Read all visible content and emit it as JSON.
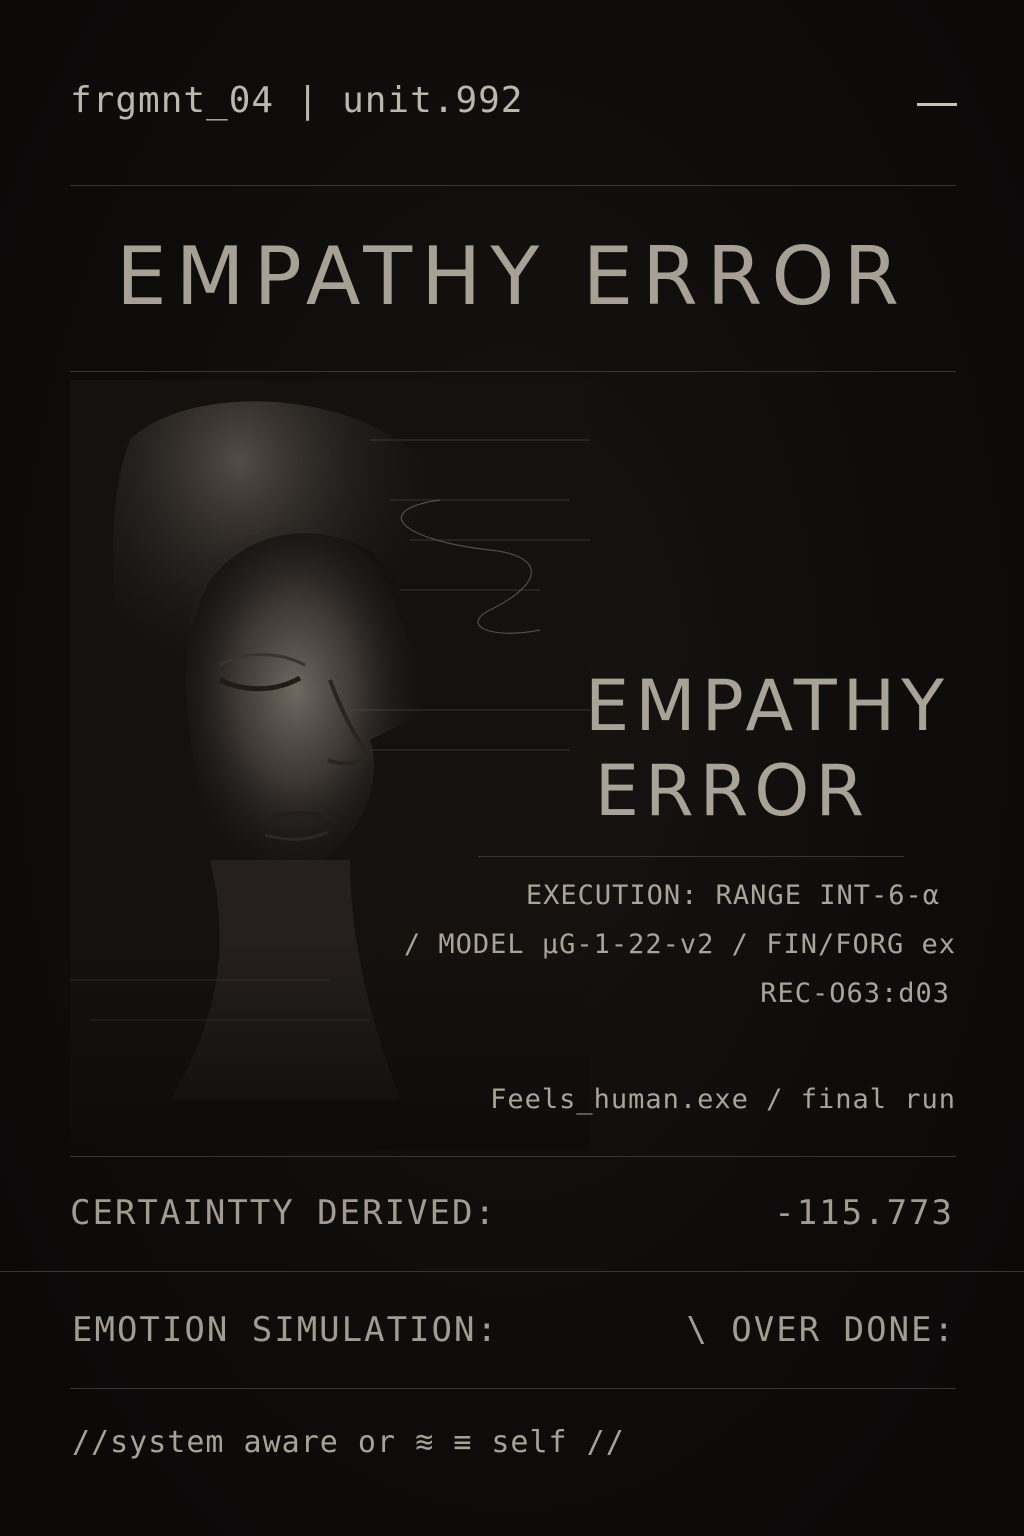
{
  "header": {
    "fragment_label": "frgmnt_04 | unit.992",
    "menu_icon": "menu-dash-icon"
  },
  "title": {
    "main": "EMPATHY ERROR",
    "overlay_line1": "EMPATHY",
    "overlay_line2": "ERROR"
  },
  "portrait": {
    "icon": "portrait-sketch"
  },
  "meta": {
    "line1": "EXECUTION: RANGE INT-6-α",
    "line2": "/ MODEL µG-1-22-v2 / FIN/FORG ex",
    "line3": "REC-O63:d03",
    "process": "Feels_human.exe / final run"
  },
  "rows": [
    {
      "label": "CERTAINTTY DERIVED:",
      "value": "-115.773"
    },
    {
      "label": "EMOTION SIMULATION:",
      "value": "\\ OVER DONE:"
    }
  ],
  "footer": {
    "text": "//system  aware or ≋  ≡   self //"
  },
  "colors": {
    "background": "#0d0b0a",
    "text": "#b9b2a8",
    "rule": "#3a3531"
  }
}
